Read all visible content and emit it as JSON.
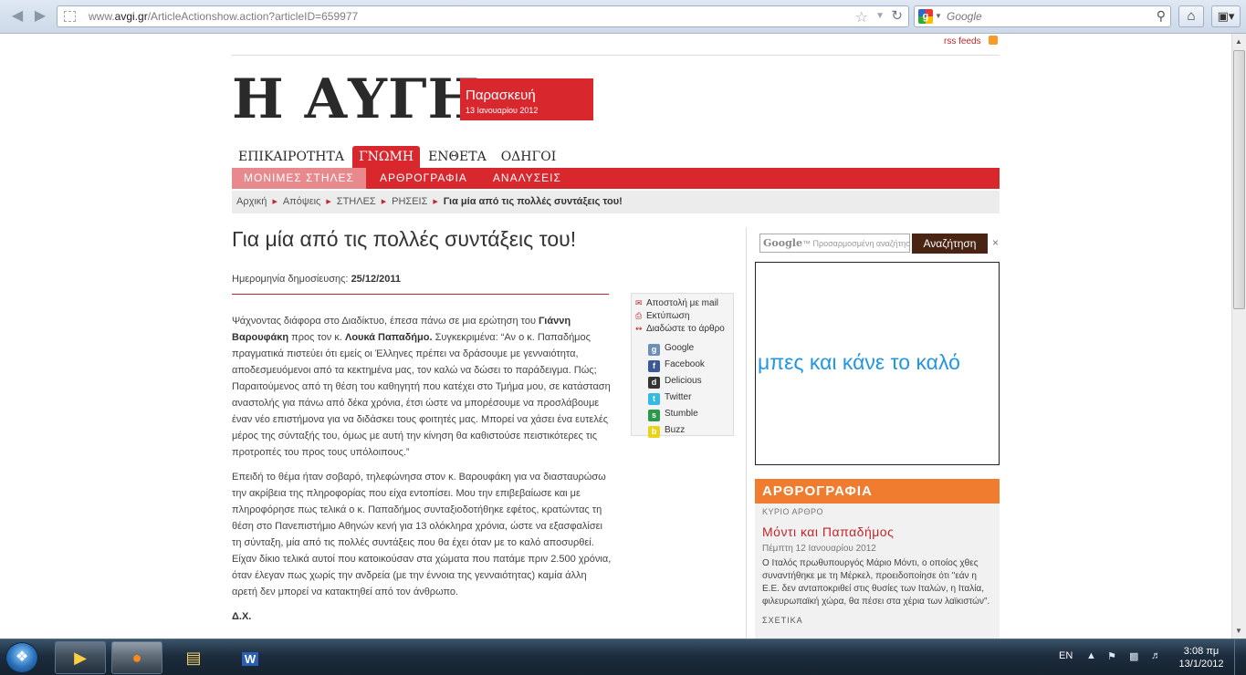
{
  "browser": {
    "url_prefix": "www.",
    "url_domain": "avgi.gr",
    "url_path": "/ArticleActionshow.action?articleID=659977",
    "search_placeholder": "Google",
    "back_icon": "back-arrow",
    "forward_icon": "forward-arrow",
    "star_icon": "star",
    "reload_icon": "reload",
    "home_icon": "home",
    "menu_icon": "menu"
  },
  "site": {
    "rss_label": "rss feeds",
    "logo": "Η ΑΥΓΗ",
    "day": "Παρασκευή",
    "date": "13 Ιανουαρίου 2012",
    "brand_color": "#d9272e",
    "main_nav": [
      "ΕΠΙΚΑΙΡΟΤΗΤΑ",
      "ΓΝΩΜΗ",
      "ΕΝΘΕΤΑ",
      "ΟΔΗΓΟΙ"
    ],
    "main_nav_active": 1,
    "sub_nav": [
      "ΜΟΝΙΜΕΣ ΣΤΗΛΕΣ",
      "ΑΡΘΡΟΓΡΑΦΙΑ",
      "ΑΝΑΛΥΣΕΙΣ"
    ],
    "sub_nav_active": 0,
    "breadcrumbs": [
      "Αρχική",
      "Απόψεις",
      "ΣΤΗΛΕΣ",
      "ΡΗΣΕΙΣ"
    ],
    "breadcrumb_current": "Για μία από τις πολλές συντάξεις του!"
  },
  "article": {
    "title": "Για μία από τις πολλές συντάξεις του!",
    "pubdate_label": "Ημερομηνία δημοσίευσης:",
    "pubdate": "25/12/2011",
    "p1_a": "Ψάχνοντας διάφορα στο Διαδίκτυο, έπεσα πάνω σε μια ερώτηση του ",
    "p1_name1": "Γιάννη Βαρουφάκη",
    "p1_b": " προς τον κ. ",
    "p1_name2": "Λουκά Παπαδήμο.",
    "p1_c": " Συγκεκριμένα: “Αν ο κ. Παπαδήμος πραγματικά πιστεύει ότι εμείς οι Έλληνες πρέπει να δράσουμε με γενναιότητα, αποδεσμευόμενοι από τα κεκτημένα μας, τον καλώ να δώσει το παράδειγμα. Πώς; Παραιτούμενος από τη θέση του καθηγητή που κατέχει στο Τμήμα μου, σε κατάσταση αναστολής για πάνω από δέκα χρόνια, έτσι ώστε να μπορέσουμε να προσλάβουμε έναν νέο επιστήμονα για να διδάσκει τους φοιτητές μας. Μπορεί να χάσει ένα ευτελές μέρος της σύνταξής του, όμως με αυτή την κίνηση θα καθιστούσε πειστικότερες τις προτροπές του προς τους υπόλοιπους.”",
    "p2": "Επειδή το θέμα ήταν σοβαρό, τηλεφώνησα στον κ. Βαρουφάκη για να διασταυρώσω την ακρίβεια της πληροφορίας που είχα εντοπίσει. Μου την επιβεβαίωσε και με πληροφόρησε πως τελικά ο κ. Παπαδήμος συνταξιοδοτήθηκε εφέτος, κρατώντας τη θέση στο Πανεπιστήμιο Αθηνών κενή για 13 ολόκληρα χρόνια, ώστε να εξασφαλίσει τη σύνταξη, μία από τις πολλές συντάξεις που θα έχει όταν με το καλό αποσυρθεί. Είχαν δίκιο τελικά αυτοί που κατοικούσαν στα χώματα που πατάμε πριν 2.500 χρόνια, όταν έλεγαν πως χωρίς την ανδρεία (με την έννοια της γενναιότητας) καμία άλλη αρετή δεν μπορεί να κατακτηθεί από τον άνθρωπο.",
    "signature": "Δ.Χ."
  },
  "tools": {
    "mail": "Αποστολή με mail",
    "print": "Εκτύπωση",
    "share": "Διαδώστε το άρθρο",
    "social": [
      {
        "label": "Google",
        "icon": "google-icon",
        "color": "#6d8fb5",
        "glyph": "g"
      },
      {
        "label": "Facebook",
        "icon": "facebook-icon",
        "color": "#3b5998",
        "glyph": "f"
      },
      {
        "label": "Delicious",
        "icon": "delicious-icon",
        "color": "#333333",
        "glyph": "d"
      },
      {
        "label": "Twitter",
        "icon": "twitter-icon",
        "color": "#33bbe6",
        "glyph": "t"
      },
      {
        "label": "Stumble",
        "icon": "stumble-icon",
        "color": "#2a9a4a",
        "glyph": "s"
      },
      {
        "label": "Buzz",
        "icon": "buzz-icon",
        "color": "#e8d21a",
        "glyph": "b"
      }
    ]
  },
  "sidebar": {
    "search_placeholder_logo": "Google",
    "search_placeholder": "Προσαρμοσμένη αναζήτηση",
    "search_button": "Αναζήτηση",
    "close": "×",
    "ad_text": "μπες και κάνε το καλό",
    "ad_color": "#2196e3",
    "section_title": "ΑΡΘΡΟΓΡΑΦΙΑ",
    "section_color": "#f07c30",
    "kicker": "ΚΥΡΙΟ ΑΡΘΡΟ",
    "headline": "Μόντι και Παπαδήμος",
    "headline_date": "Πέμπτη 12 Ιανουαρίου 2012",
    "teaser": "Ο Ιταλός πρωθυπουργός Μάριο Μόντι, ο οποίος χθες συναντήθηκε με τη Μέρκελ, προειδοποίησε ότι \"εάν η Ε.Ε. δεν ανταποκριθεί στις θυσίες των Ιταλών, η Ιταλία, φιλευρωπαϊκή χώρα, θα πέσει στα χέρια των λαϊκιστών\".",
    "more": "ΣΧΕΤΙΚΑ"
  },
  "taskbar": {
    "apps": [
      "windows-media-player-icon",
      "firefox-icon",
      "explorer-icon",
      "word-icon"
    ],
    "active_app": 1,
    "lang": "EN",
    "time": "3:08 πμ",
    "date": "13/1/2012"
  }
}
